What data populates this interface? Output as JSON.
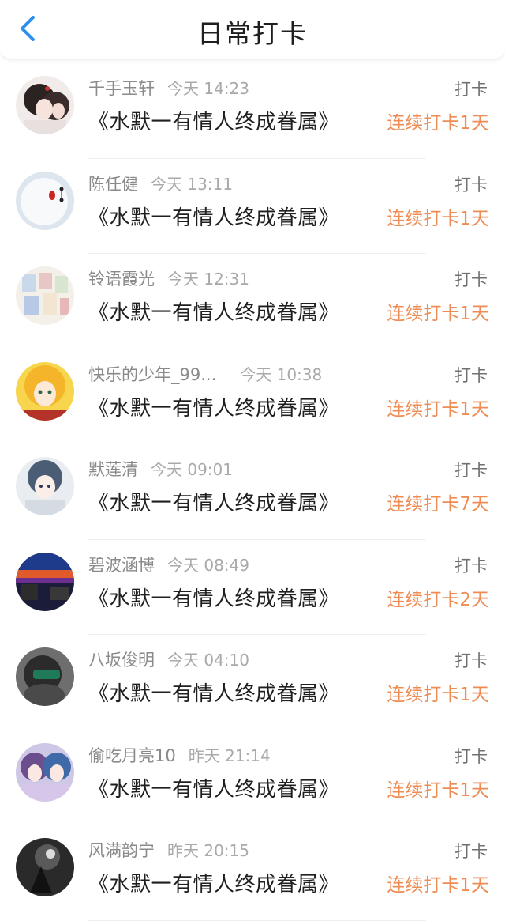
{
  "header": {
    "title": "日常打卡",
    "back_icon": "chevron-left-icon",
    "accent_color": "#2f8ff0"
  },
  "colors": {
    "streak": "#ef8c54"
  },
  "items": [
    {
      "user": "千手玉轩",
      "time": "今天 14:23",
      "content": "《水默一有情人终成眷属》",
      "badge": "打卡",
      "streak": "连续打卡1天",
      "avatar": "avatar-anime-couple"
    },
    {
      "user": "陈任健",
      "time": "今天 13:11",
      "content": "《水默一有情人终成眷属》",
      "badge": "打卡",
      "streak": "连续打卡1天",
      "avatar": "avatar-white-robot"
    },
    {
      "user": "铃语霞光",
      "time": "今天 12:31",
      "content": "《水默一有情人终成眷属》",
      "badge": "打卡",
      "streak": "连续打卡1天",
      "avatar": "avatar-painting-collage"
    },
    {
      "user": "快乐的少年_99...",
      "time": "今天 10:38",
      "content": "《水默一有情人终成眷属》",
      "badge": "打卡",
      "streak": "连续打卡1天",
      "avatar": "avatar-anime-fox-girl"
    },
    {
      "user": "默莲清",
      "time": "今天 09:01",
      "content": "《水默一有情人终成眷属》",
      "badge": "打卡",
      "streak": "连续打卡7天",
      "avatar": "avatar-anime-girl-blue"
    },
    {
      "user": "碧波涵博",
      "time": "今天 08:49",
      "content": "《水默一有情人终成眷属》",
      "badge": "打卡",
      "streak": "连续打卡2天",
      "avatar": "avatar-sunset-city"
    },
    {
      "user": "八坂俊明",
      "time": "今天 04:10",
      "content": "《水默一有情人终成眷属》",
      "badge": "打卡",
      "streak": "连续打卡1天",
      "avatar": "avatar-person-vr"
    },
    {
      "user": "偷吃月亮10",
      "time": "昨天 21:14",
      "content": "《水默一有情人终成眷属》",
      "badge": "打卡",
      "streak": "连续打卡1天",
      "avatar": "avatar-anime-two-girls"
    },
    {
      "user": "风满韵宁",
      "time": "昨天 20:15",
      "content": "《水默一有情人终成眷属》",
      "badge": "打卡",
      "streak": "连续打卡1天",
      "avatar": "avatar-dark-silhouette"
    }
  ]
}
